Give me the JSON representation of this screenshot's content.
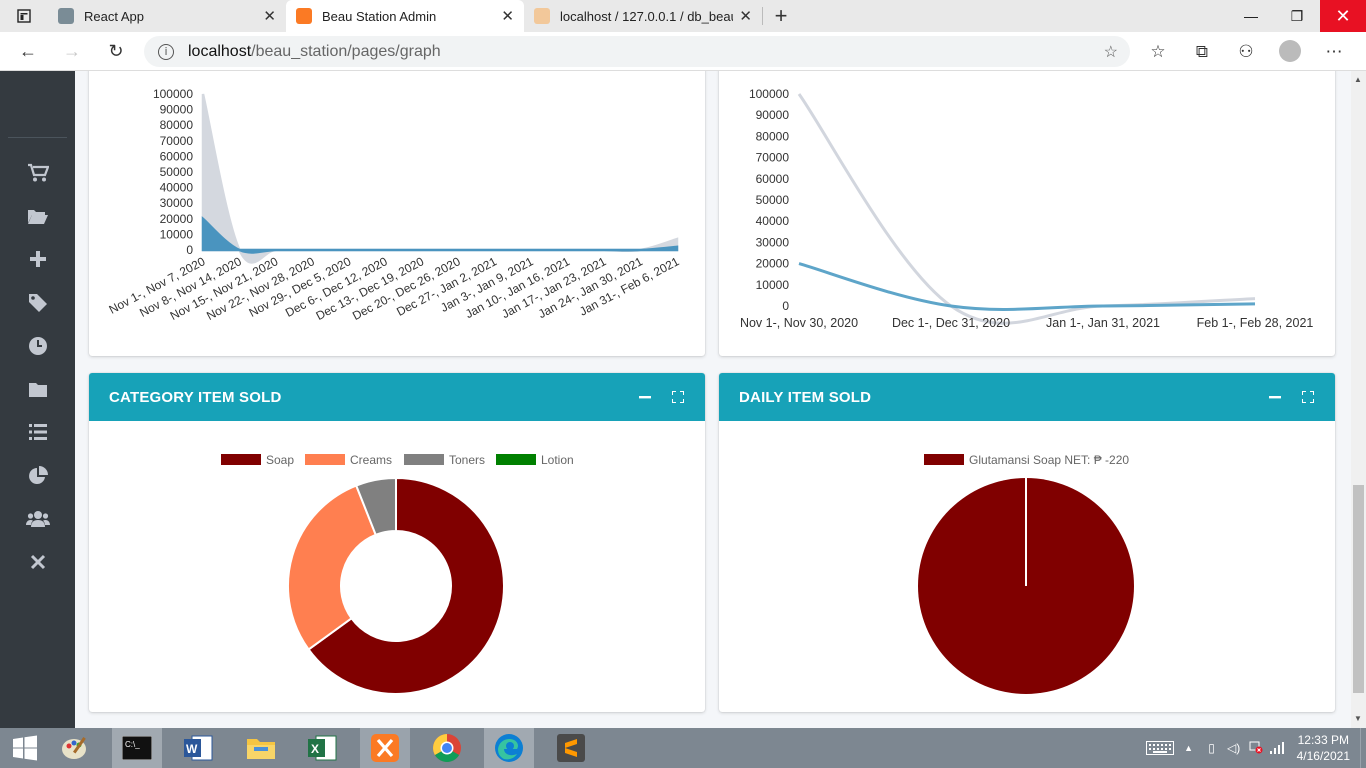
{
  "browser": {
    "tabs": [
      {
        "title": "React App",
        "active": false
      },
      {
        "title": "Beau Station Admin",
        "active": true
      },
      {
        "title": "localhost / 127.0.0.1 / db_beau_i",
        "active": false
      }
    ],
    "url_host": "localhost",
    "url_path": "/beau_station/pages/graph"
  },
  "sidebar": {
    "icons": [
      "cart-icon",
      "folder-open-icon",
      "plus-icon",
      "tag-icon",
      "clock-icon",
      "folder-icon",
      "list-icon",
      "pie-chart-icon",
      "users-icon",
      "close-icon"
    ]
  },
  "cards": {
    "category": {
      "title": "CATEGORY ITEM SOLD"
    },
    "daily": {
      "title": "DAILY ITEM SOLD"
    }
  },
  "taskbar": {
    "apps": [
      "windows-start-icon",
      "paint-icon",
      "cmd-icon",
      "word-icon",
      "file-explorer-icon",
      "excel-icon",
      "xampp-icon",
      "chrome-icon",
      "edge-icon",
      "sublime-icon"
    ],
    "time": "12:33 PM",
    "date": "4/16/2021"
  },
  "chart_data": [
    {
      "type": "area",
      "title": "",
      "xlabel": "",
      "ylabel": "",
      "ylim": [
        0,
        100000
      ],
      "yticks": [
        "100000",
        "90000",
        "80000",
        "70000",
        "60000",
        "50000",
        "40000",
        "30000",
        "20000",
        "10000",
        "0"
      ],
      "categories": [
        "Nov 1-, Nov 7, 2020",
        "Nov 8-, Nov 14, 2020",
        "Nov 15-, Nov 21, 2020",
        "Nov 22-, Nov 28, 2020",
        "Nov 29-, Dec 5, 2020",
        "Dec 6-, Dec 12, 2020",
        "Dec 13-, Dec 19, 2020",
        "Dec 20-, Dec 26, 2020",
        "Dec 27-, Jan 2, 2021",
        "Jan 3-, Jan 9, 2021",
        "Jan 10-, Jan 16, 2021",
        "Jan 17-, Jan 23, 2021",
        "Jan 24-, Jan 30, 2021",
        "Jan 31-, Feb 6, 2021"
      ],
      "series": [
        {
          "color": "#d2d6de",
          "values": [
            100000,
            0,
            0,
            0,
            0,
            0,
            0,
            0,
            0,
            0,
            0,
            0,
            0,
            7000
          ]
        },
        {
          "color": "#3c8dbc",
          "values": [
            20000,
            0,
            0,
            0,
            0,
            0,
            0,
            0,
            0,
            0,
            0,
            0,
            0,
            2000
          ]
        }
      ],
      "grid": false,
      "legend": "none"
    },
    {
      "type": "line",
      "title": "",
      "xlabel": "",
      "ylabel": "",
      "ylim": [
        0,
        100000
      ],
      "yticks": [
        "100000",
        "90000",
        "80000",
        "70000",
        "60000",
        "50000",
        "40000",
        "30000",
        "20000",
        "10000",
        "0"
      ],
      "categories": [
        "Nov 1-, Nov 30, 2020",
        "Dec 1-, Dec 31, 2020",
        "Jan 1-, Jan 31, 2021",
        "Feb 1-, Feb 28, 2021"
      ],
      "series": [
        {
          "color": "#d2d6de",
          "values": [
            100000,
            0,
            0,
            3500
          ]
        },
        {
          "color": "#5ea5c9",
          "values": [
            20000,
            0,
            0,
            1000
          ]
        }
      ],
      "grid": false,
      "legend": "none"
    },
    {
      "type": "pie",
      "variant": "doughnut",
      "title": "CATEGORY ITEM SOLD",
      "categories": [
        "Soap",
        "Creams",
        "Toners",
        "Lotion"
      ],
      "values": [
        65,
        29,
        6,
        0
      ],
      "colors": [
        "#800000",
        "#ff7f50",
        "#808080",
        "#008000"
      ],
      "legend": "top"
    },
    {
      "type": "pie",
      "title": "DAILY ITEM SOLD",
      "categories": [
        "Glutamansi Soap NET: ₱ -220"
      ],
      "values": [
        100
      ],
      "colors": [
        "#800000"
      ],
      "legend": "top"
    }
  ]
}
